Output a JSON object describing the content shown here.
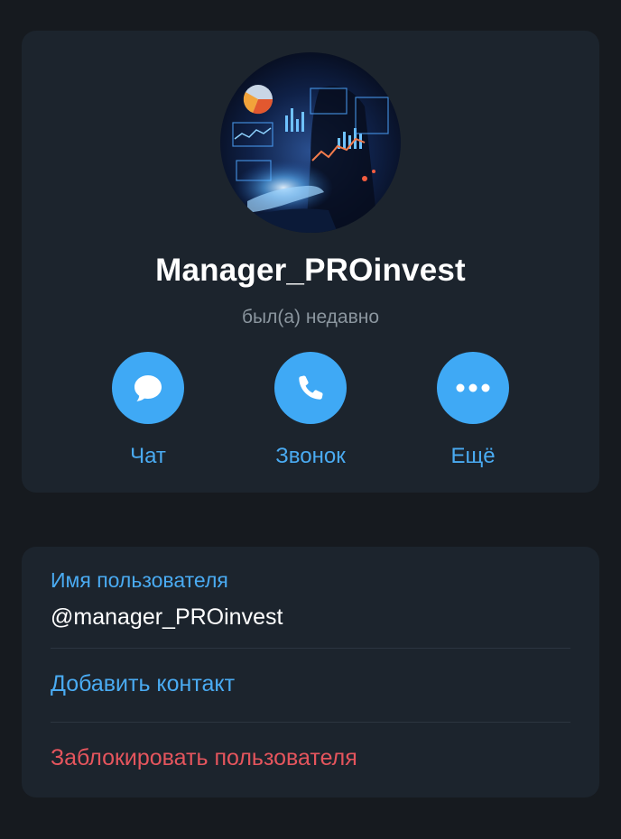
{
  "profile": {
    "name": "Manager_PROinvest",
    "status": "был(а) недавно",
    "avatar_icon": "finance-dashboard-avatar"
  },
  "actions": {
    "chat": {
      "label": "Чат",
      "icon": "chat-bubble-icon"
    },
    "call": {
      "label": "Звонок",
      "icon": "phone-icon"
    },
    "more": {
      "label": "Ещё",
      "icon": "more-dots-icon"
    }
  },
  "info": {
    "username_caption": "Имя пользователя",
    "username_value": "@manager_PROinvest",
    "add_contact": "Добавить контакт",
    "block_user": "Заблокировать пользователя"
  },
  "colors": {
    "background": "#161a1f",
    "card": "#1c242d",
    "accent": "#3fa9f5",
    "link": "#4aabf2",
    "danger": "#e5555d",
    "muted": "#8b969f"
  }
}
